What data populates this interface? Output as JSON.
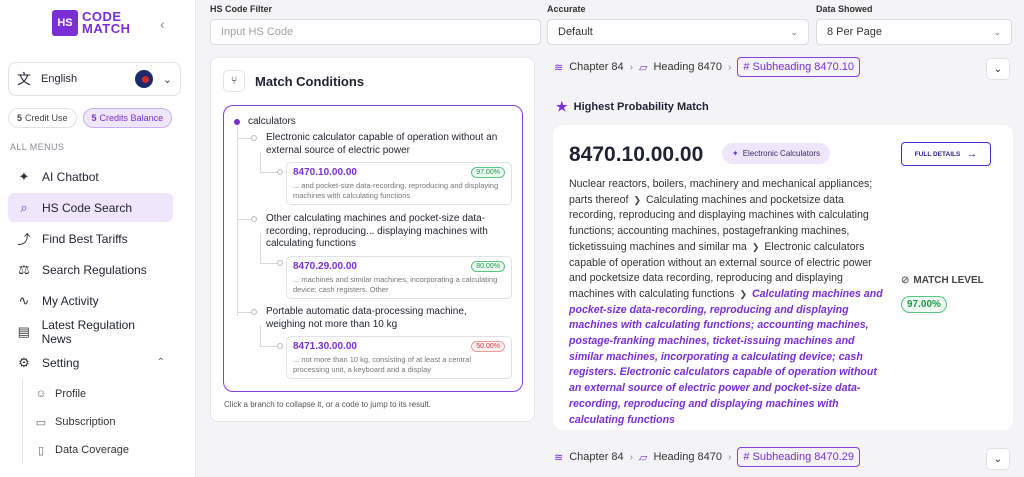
{
  "brand": {
    "logo_mark": "HS",
    "line1": "CODE",
    "line2": "MATCH"
  },
  "sidebar": {
    "language": "English",
    "credits": [
      {
        "num": "5",
        "label": "Credit Use"
      },
      {
        "num": "5",
        "label": "Credits Balance"
      }
    ],
    "menu_label": "ALL MENUS",
    "items": [
      {
        "label": "AI Chatbot"
      },
      {
        "label": "HS Code Search"
      },
      {
        "label": "Find Best Tariffs"
      },
      {
        "label": "Search Regulations"
      },
      {
        "label": "My Activity"
      },
      {
        "label": "Latest Regulation News"
      },
      {
        "label": "Setting"
      }
    ],
    "subitems": [
      {
        "label": "Profile"
      },
      {
        "label": "Subscription"
      },
      {
        "label": "Data Coverage"
      }
    ]
  },
  "filters": {
    "hs_label": "HS Code Filter",
    "hs_placeholder": "Input HS Code",
    "accurate_label": "Accurate",
    "accurate_value": "Default",
    "data_label": "Data Showed",
    "data_value": "8 Per Page"
  },
  "match_conditions": {
    "title": "Match Conditions",
    "root": "calculators",
    "branches": [
      {
        "text": "Electronic calculator capable of operation without an external source of electric power",
        "code": "8470.10.00.00",
        "desc": "... and pocket-size data-recording, reproducing and displaying machines with calculating functions",
        "pct": "97.00%"
      },
      {
        "text": "Other calculating machines and pocket-size data-recording, reproducing... displaying machines with calculating functions",
        "code": "8470.29.00.00",
        "desc": "... machines and similar machines, incorporating a calculating device; cash registers. Other",
        "pct": "80.00%"
      },
      {
        "text": "Portable automatic data-processing machine, weighing not more than 10 kg",
        "code": "8471.30.00.00",
        "desc": "... not more than 10 kg, consisting of at least a central processing unit, a keyboard and a display",
        "pct": "50.00%"
      }
    ],
    "help": "Click a branch to collapse it, or a code to jump to its result."
  },
  "breadcrumb1": {
    "chapter": "Chapter 84",
    "heading": "Heading 8470",
    "subheading": "# Subheading 8470.10"
  },
  "breadcrumb2": {
    "chapter": "Chapter 84",
    "heading": "Heading 8470",
    "subheading": "# Subheading 8470.29"
  },
  "highest_label": "Highest Probability Match",
  "result": {
    "code": "8470.10.00.00",
    "tag": "Electronic Calculators",
    "full_details": "FULL DETAILS",
    "desc_parts": [
      "Nuclear reactors, boilers, machinery and mechanical appliances; parts thereof",
      "Calculating machines and pocketsize data recording, reproducing and displaying machines with calculating functions; accounting machines, postagefranking machines, ticketissuing machines and similar ma",
      "Electronic calculators capable of operation without an external source of electric power and pocketsize data recording, reproducing and displaying machines with calculating functions"
    ],
    "highlight": "Calculating machines and pocket-size data-recording, reproducing and displaying machines with calculating functions; accounting machines, postage-franking machines, ticket-issuing machines and similar machines, incorporating a calculating device; cash registers. Electronic calculators capable of operation without an external source of electric power and pocket-size data-recording, reproducing and displaying machines with calculating functions",
    "match_level_label": "MATCH LEVEL",
    "match_level": "97.00%"
  },
  "colors": {
    "accent": "#7a2fd6",
    "success": "#1b9a4a",
    "danger": "#d43a3a"
  }
}
